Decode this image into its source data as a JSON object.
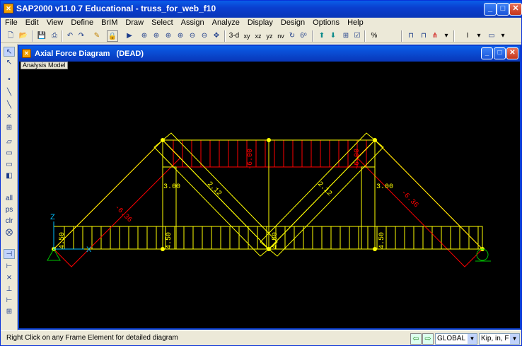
{
  "app": {
    "title": "SAP2000 v11.0.7 Educational  - truss_for_web_f10",
    "icon_name": "sap-app-icon"
  },
  "menu": [
    "File",
    "Edit",
    "View",
    "Define",
    "BrIM",
    "Draw",
    "Select",
    "Assign",
    "Analyze",
    "Display",
    "Design",
    "Options",
    "Help"
  ],
  "toolbar": {
    "icons": [
      "new-icon",
      "open-icon",
      "save-icon",
      "print-icon",
      "undo-icon",
      "redo-icon",
      "pencil-icon",
      "lock-icon",
      "run-icon",
      "zoom-in-icon",
      "zoom-out-icon",
      "zoom-window-icon",
      "restore-icon",
      "zoom-prev-icon",
      "zoom-all-icon",
      "pan-icon"
    ],
    "view_labels": [
      "3-d",
      "xy",
      "xz",
      "yz",
      "nv"
    ],
    "percent_label": "%"
  },
  "child_window": {
    "title": "Axial Force Diagram   (DEAD)",
    "tag": "Analysis Model"
  },
  "diagram": {
    "axis_z": "Z",
    "axis_x": "X",
    "labels": {
      "top_chord": "-6.00",
      "top_chord_right": "-6.00",
      "left_diag": "-6.36",
      "right_diag": "-6.36",
      "left_vertical": "3.00",
      "right_vertical": "3.00",
      "inner_diag_left": "2.12",
      "inner_diag_right": "2.12",
      "bottom_1": "4.50",
      "bottom_2": "4.50",
      "bottom_3": "4.50",
      "bottom_4": "4.50"
    },
    "colors": {
      "structure": "#ffff00",
      "compression": "#ff0000",
      "tension": "#ffff00",
      "support": "#00c000"
    }
  },
  "status": {
    "message": "Right Click on any Frame Element for detailed diagram",
    "coord_system": "GLOBAL",
    "units": "Kip, in, F"
  }
}
